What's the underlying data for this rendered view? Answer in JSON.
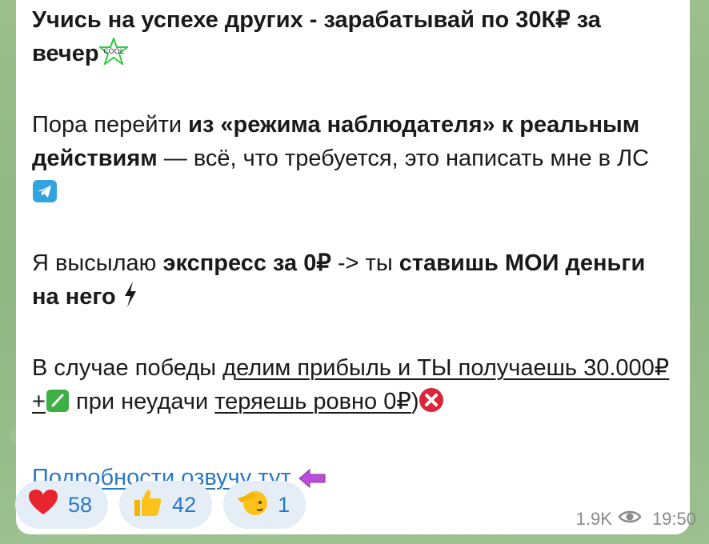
{
  "message": {
    "title_line": "Учись на успехе других - зарабатывай по 30К₽ за вечер",
    "title_emoji": "cool-star-emoji",
    "p2_a": "Пора перейти ",
    "p2_b": "из «режима наблюдателя» к реальным действиям",
    "p2_c": " — всё, что требуется, это написать мне в ЛС",
    "p3_a": "Я высылаю ",
    "p3_b": "экспресс за 0₽",
    "p3_c": " -> ты ",
    "p3_d": "ставишь МОИ деньги на него",
    "p4_a": "В случае победы д",
    "p4_b": "елим прибыль и ТЫ получаешь 30.000₽+",
    "p4_c": " при неудачи ",
    "p4_d": "теряешь ровно 0₽",
    "p4_e": ")",
    "link": "Подробности озвучу тут"
  },
  "reactions": [
    {
      "emoji": "heart-icon",
      "count": "58"
    },
    {
      "emoji": "thumbs-up-icon",
      "count": "42"
    },
    {
      "emoji": "saluting-face-icon",
      "count": "1"
    }
  ],
  "meta": {
    "views": "1.9K",
    "time": "19:50"
  },
  "colors": {
    "link": "#2a78c8",
    "bubble": "#ffffff",
    "reaction_bg": "#e5eef7",
    "background": "#8fb58a"
  }
}
